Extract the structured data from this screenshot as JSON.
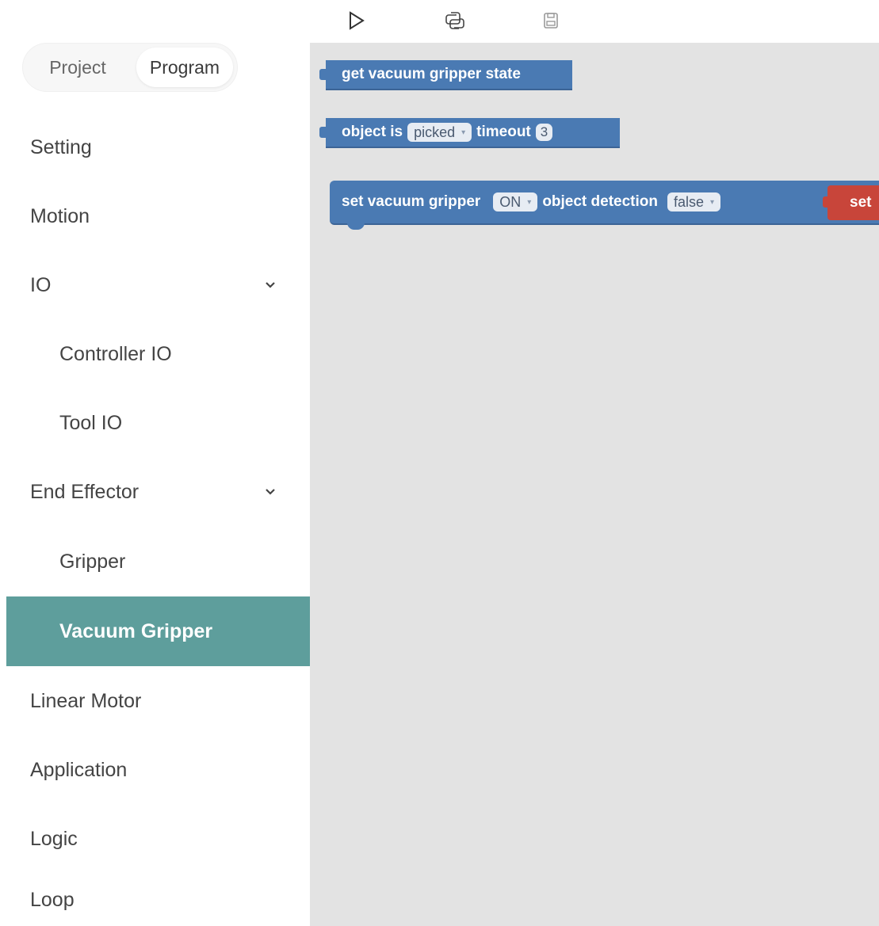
{
  "sidebar": {
    "tabs": {
      "project": "Project",
      "program": "Program",
      "selected": "Program"
    },
    "items": [
      {
        "label": "Setting",
        "level": 0
      },
      {
        "label": "Motion",
        "level": 0
      },
      {
        "label": "IO",
        "level": 0,
        "expanded": true
      },
      {
        "label": "Controller IO",
        "level": 1
      },
      {
        "label": "Tool IO",
        "level": 1
      },
      {
        "label": "End Effector",
        "level": 0,
        "expanded": true
      },
      {
        "label": "Gripper",
        "level": 1
      },
      {
        "label": "Vacuum Gripper",
        "level": 1,
        "active": true
      },
      {
        "label": "Linear Motor",
        "level": 0
      },
      {
        "label": "Application",
        "level": 0
      },
      {
        "label": "Logic",
        "level": 0
      },
      {
        "label": "Loop",
        "level": 0
      }
    ]
  },
  "toolbar": {
    "icons": [
      "play-icon",
      "python-icon",
      "save-icon"
    ]
  },
  "blocks": {
    "get_state": {
      "text": "get vacuum gripper state"
    },
    "object_is": {
      "prefix": "object is",
      "state": "picked",
      "timeout_label": "timeout",
      "timeout": "3"
    },
    "set_gripper": {
      "prefix": "set vacuum gripper",
      "state": "ON",
      "detection_label": "object detection",
      "detection": "false",
      "attached": "set"
    }
  },
  "colors": {
    "active_item": "#5e9e9c",
    "block_blue": "#4a7ab3",
    "block_red": "#c8453a",
    "workspace": "#e3e3e3"
  }
}
